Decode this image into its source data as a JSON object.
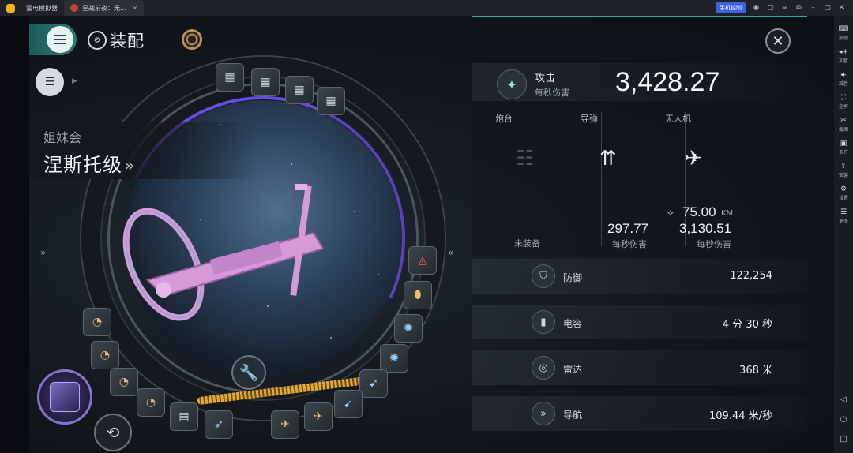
{
  "emulator": {
    "app_name": "雷电模拟器",
    "tab_title": "星战前夜：无...",
    "phone_control": "手机控制",
    "sidebar": [
      {
        "glyph": "⌨",
        "label": "按键"
      },
      {
        "glyph": "◂+",
        "label": "加音"
      },
      {
        "glyph": "◂-",
        "label": "减音"
      },
      {
        "glyph": "⛶",
        "label": "全屏"
      },
      {
        "glyph": "✂",
        "label": "截图"
      },
      {
        "glyph": "▣",
        "label": "多开"
      },
      {
        "glyph": "⇪",
        "label": "安装"
      },
      {
        "glyph": "⚙",
        "label": "设置"
      },
      {
        "glyph": "☰",
        "label": "更多"
      }
    ]
  },
  "header": {
    "title": "装配"
  },
  "ship": {
    "corporation": "姐妹会",
    "name": "涅斯托级",
    "chevron": "»"
  },
  "attack": {
    "label": "攻击",
    "sub": "每秒伤害",
    "value": "3,428.27"
  },
  "weapons": {
    "turret": {
      "label": "炮台",
      "status": "未装备"
    },
    "missile": {
      "label": "导弹",
      "value": "297.77",
      "sub": "每秒伤害"
    },
    "drone": {
      "label": "无人机",
      "range": "75.00",
      "range_unit": "KM",
      "value": "3,130.51",
      "sub": "每秒伤害"
    }
  },
  "stats": [
    {
      "label": "防御",
      "value": "122,254",
      "icon": "shield-icon"
    },
    {
      "label": "电容",
      "value": "4 分 30 秒",
      "icon": "capacitor-icon"
    },
    {
      "label": "雷达",
      "value": "368 米",
      "icon": "radar-icon"
    },
    {
      "label": "导航",
      "value": "109.44 米/秒",
      "icon": "navigation-icon"
    }
  ],
  "colors": {
    "accent_teal": "#2ea89f",
    "energy": "#e2a93a",
    "ship_pink": "#d79ad9",
    "purple": "#6a4de0"
  }
}
